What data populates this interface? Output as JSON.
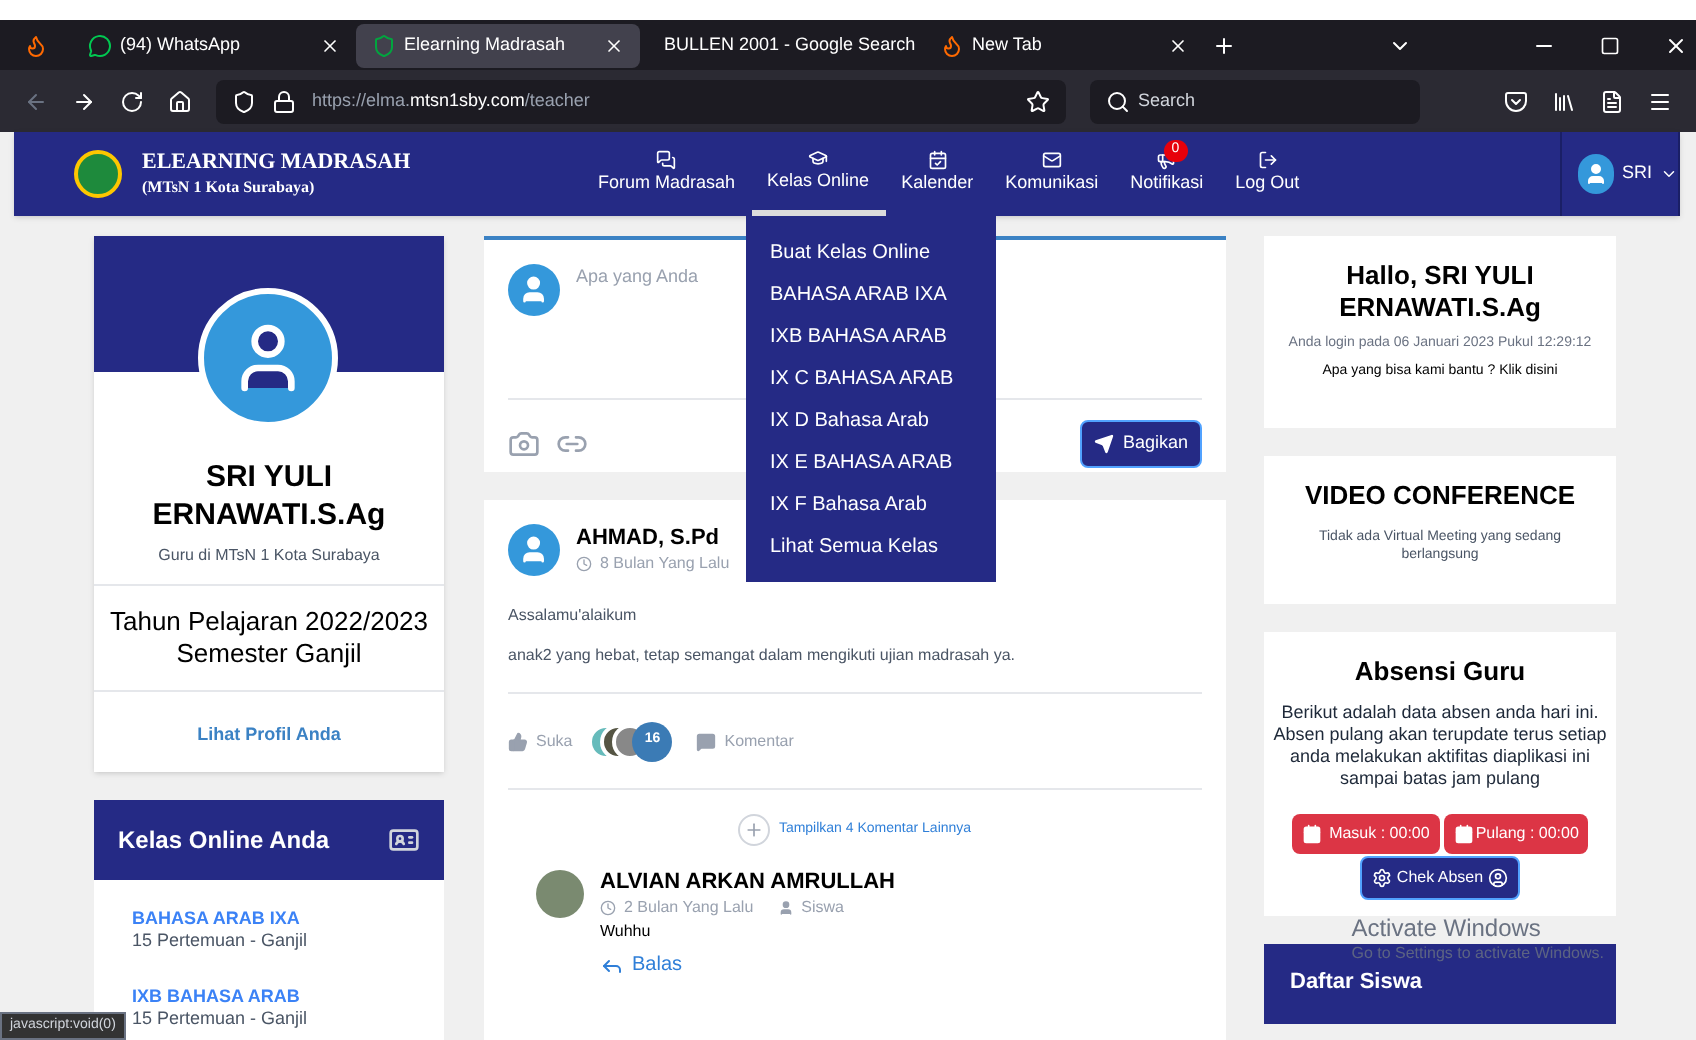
{
  "browser": {
    "tabs": [
      {
        "title": "(94) WhatsApp",
        "kind": "whatsapp",
        "selected": false
      },
      {
        "title": "Elearning Madrasah",
        "kind": "site",
        "selected": true
      },
      {
        "title": "BULLEN 2001 - Google Search",
        "kind": "google",
        "selected": false
      },
      {
        "title": "New Tab",
        "kind": "firefox",
        "selected": false
      }
    ],
    "address_host": "https://elma.",
    "address_domain": "mtsn1sby.com",
    "address_path": "/teacher",
    "search_placeholder": "Search"
  },
  "navbar": {
    "brand": "ELEARNING MADRASAH",
    "subtitle": "(MTsN 1 Kota Surabaya)",
    "items": [
      {
        "label": "Forum Madrasah",
        "kind": "comments",
        "selected": false
      },
      {
        "label": "Kelas Online",
        "kind": "cap",
        "selected": true
      },
      {
        "label": "Kalender",
        "kind": "calendar",
        "selected": false
      },
      {
        "label": "Komunikasi",
        "kind": "mail",
        "selected": false
      },
      {
        "label": "Notifikasi",
        "kind": "megaphone",
        "badge": "0",
        "selected": false
      },
      {
        "label": "Log Out",
        "kind": "logout",
        "selected": false
      }
    ],
    "user": "SRI"
  },
  "dropdown": [
    "Buat Kelas Online",
    "BAHASA ARAB IXA",
    "IXB BAHASA ARAB",
    "IX C BAHASA ARAB",
    "IX D Bahasa Arab",
    "IX E BAHASA ARAB",
    "IX F Bahasa Arab",
    "Lihat Semua Kelas"
  ],
  "profile": {
    "name": "SRI YULI ERNAWATI.S.Ag",
    "role": "Guru di MTsN 1 Kota Surabaya",
    "year": "Tahun Pelajaran 2022/2023",
    "semester": "Semester Ganjil",
    "link": "Lihat Profil Anda"
  },
  "classes": {
    "title": "Kelas Online Anda",
    "items": [
      {
        "name": "BAHASA ARAB IXA",
        "meta": "15 Pertemuan - Ganjil"
      },
      {
        "name": "IXB BAHASA ARAB",
        "meta": "15 Pertemuan - Ganjil"
      }
    ]
  },
  "composer": {
    "placeholder": "Apa yang Anda",
    "button": "Bagikan"
  },
  "post": {
    "author": "AHMAD, S.Pd",
    "time": "8 Bulan Yang Lalu",
    "body": [
      "Assalamu'alaikum",
      "anak2 yang hebat, tetap semangat dalam mengikuti ujian madrasah ya."
    ],
    "like": "Suka",
    "like_count": "16",
    "comment": "Komentar",
    "more": "Tampilkan 4 Komentar Lainnya",
    "reply": {
      "author": "ALVIAN ARKAN AMRULLAH",
      "time": "2 Bulan Yang Lalu",
      "role": "Siswa",
      "text": "Wuhhu",
      "action": "Balas"
    }
  },
  "welcome": {
    "title": "Hallo, SRI YULI ERNAWATI.S.Ag",
    "login": "Anda login pada 06 Januari 2023 Pukul 12:29:12",
    "help": "Apa yang bisa kami bantu ? Klik disini"
  },
  "video": {
    "title": "VIDEO CONFERENCE",
    "text": "Tidak ada Virtual Meeting yang sedang berlangsung"
  },
  "absensi": {
    "title": "Absensi Guru",
    "text": "Berikut adalah data absen anda hari ini. Absen pulang akan terupdate terus setiap anda melakukan aktifitas diaplikasi ini sampai batas jam pulang",
    "masuk": "Masuk : 00:00",
    "pulang": "Pulang : 00:00",
    "check": "Chek Absen"
  },
  "students": {
    "title": "Daftar Siswa"
  },
  "status_url": "javascript:void(0)",
  "os_notice": {
    "title": "Activate Windows",
    "text": "Go to Settings to activate Windows."
  }
}
